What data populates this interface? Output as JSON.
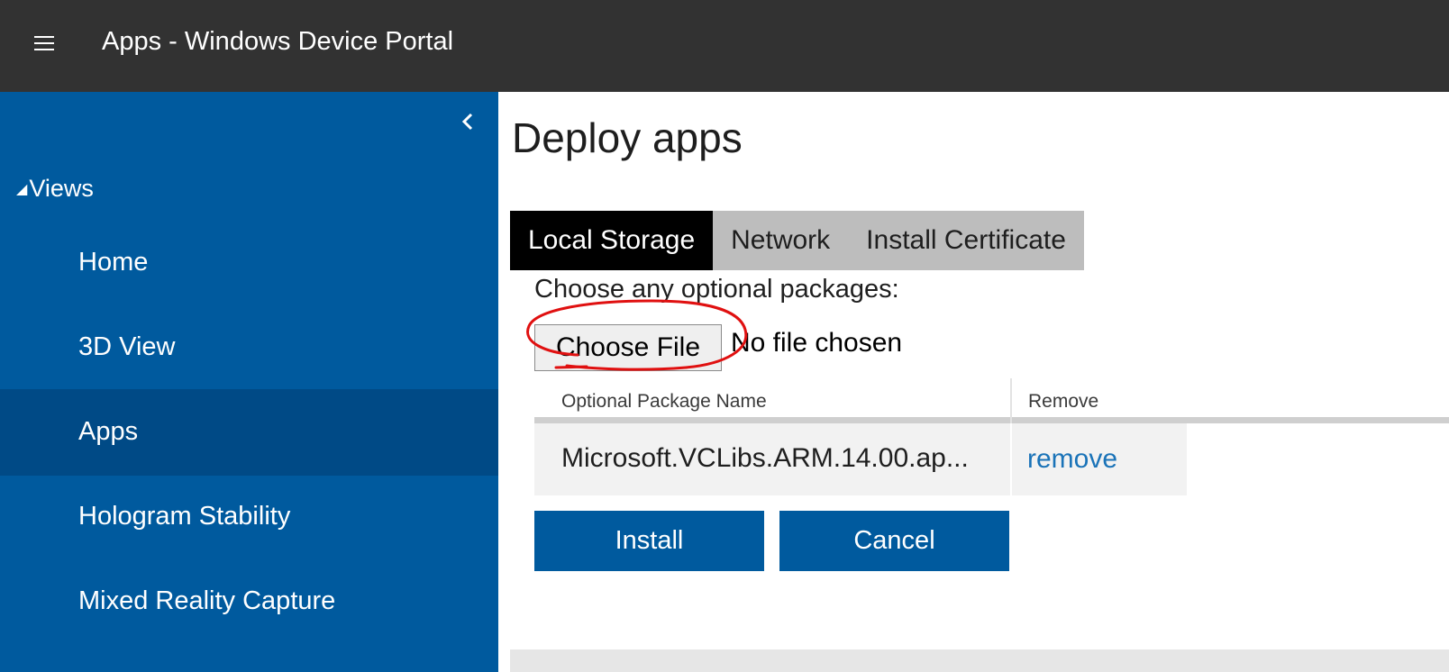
{
  "header": {
    "title": "Apps - Windows Device Portal",
    "menu_icon": "hamburger-icon"
  },
  "sidebar": {
    "collapse_icon": "chevron-left-icon",
    "section_label": "Views",
    "section_icon": "triangle-down-icon",
    "items": [
      {
        "label": "Home",
        "active": false
      },
      {
        "label": "3D View",
        "active": false
      },
      {
        "label": "Apps",
        "active": true
      },
      {
        "label": "Hologram Stability",
        "active": false
      },
      {
        "label": "Mixed Reality Capture",
        "active": false
      }
    ]
  },
  "main": {
    "title": "Deploy apps",
    "tabs": [
      {
        "label": "Local Storage",
        "active": true
      },
      {
        "label": "Network",
        "active": false
      },
      {
        "label": "Install Certificate",
        "active": false
      }
    ],
    "optional_label": "Choose any optional packages:",
    "file_input": {
      "button_label": "Choose File",
      "status": "No file chosen"
    },
    "table": {
      "headers": [
        "Optional Package Name",
        "Remove"
      ],
      "rows": [
        {
          "name": "Microsoft.VCLibs.ARM.14.00.ap...",
          "action": "remove"
        }
      ]
    },
    "buttons": {
      "install": "Install",
      "cancel": "Cancel"
    }
  },
  "colors": {
    "topbar": "#323232",
    "sidebar": "#005a9e",
    "sidebar_active": "#004a86",
    "accent": "#005a9e",
    "link": "#1a73b8",
    "annotation": "#e01010"
  }
}
